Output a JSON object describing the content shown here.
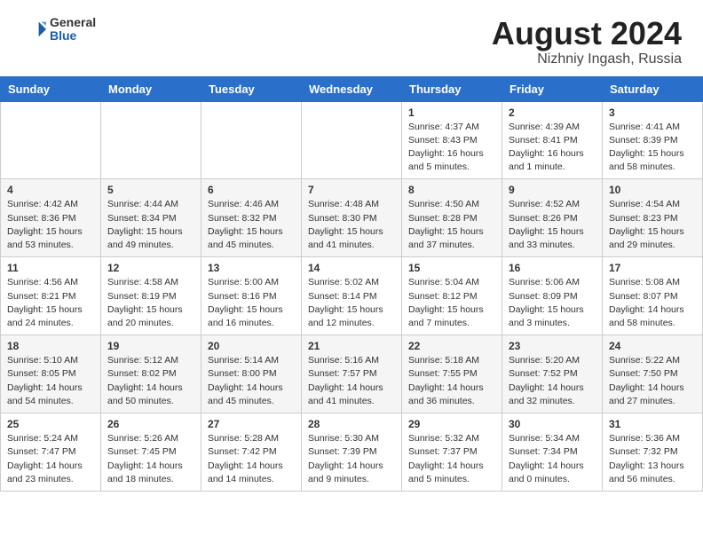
{
  "header": {
    "logo_general": "General",
    "logo_blue": "Blue",
    "month_year": "August 2024",
    "location": "Nizhniy Ingash, Russia"
  },
  "days_of_week": [
    "Sunday",
    "Monday",
    "Tuesday",
    "Wednesday",
    "Thursday",
    "Friday",
    "Saturday"
  ],
  "weeks": [
    [
      {
        "day": "",
        "info": ""
      },
      {
        "day": "",
        "info": ""
      },
      {
        "day": "",
        "info": ""
      },
      {
        "day": "",
        "info": ""
      },
      {
        "day": "1",
        "info": "Sunrise: 4:37 AM\nSunset: 8:43 PM\nDaylight: 16 hours\nand 5 minutes."
      },
      {
        "day": "2",
        "info": "Sunrise: 4:39 AM\nSunset: 8:41 PM\nDaylight: 16 hours\nand 1 minute."
      },
      {
        "day": "3",
        "info": "Sunrise: 4:41 AM\nSunset: 8:39 PM\nDaylight: 15 hours\nand 58 minutes."
      }
    ],
    [
      {
        "day": "4",
        "info": "Sunrise: 4:42 AM\nSunset: 8:36 PM\nDaylight: 15 hours\nand 53 minutes."
      },
      {
        "day": "5",
        "info": "Sunrise: 4:44 AM\nSunset: 8:34 PM\nDaylight: 15 hours\nand 49 minutes."
      },
      {
        "day": "6",
        "info": "Sunrise: 4:46 AM\nSunset: 8:32 PM\nDaylight: 15 hours\nand 45 minutes."
      },
      {
        "day": "7",
        "info": "Sunrise: 4:48 AM\nSunset: 8:30 PM\nDaylight: 15 hours\nand 41 minutes."
      },
      {
        "day": "8",
        "info": "Sunrise: 4:50 AM\nSunset: 8:28 PM\nDaylight: 15 hours\nand 37 minutes."
      },
      {
        "day": "9",
        "info": "Sunrise: 4:52 AM\nSunset: 8:26 PM\nDaylight: 15 hours\nand 33 minutes."
      },
      {
        "day": "10",
        "info": "Sunrise: 4:54 AM\nSunset: 8:23 PM\nDaylight: 15 hours\nand 29 minutes."
      }
    ],
    [
      {
        "day": "11",
        "info": "Sunrise: 4:56 AM\nSunset: 8:21 PM\nDaylight: 15 hours\nand 24 minutes."
      },
      {
        "day": "12",
        "info": "Sunrise: 4:58 AM\nSunset: 8:19 PM\nDaylight: 15 hours\nand 20 minutes."
      },
      {
        "day": "13",
        "info": "Sunrise: 5:00 AM\nSunset: 8:16 PM\nDaylight: 15 hours\nand 16 minutes."
      },
      {
        "day": "14",
        "info": "Sunrise: 5:02 AM\nSunset: 8:14 PM\nDaylight: 15 hours\nand 12 minutes."
      },
      {
        "day": "15",
        "info": "Sunrise: 5:04 AM\nSunset: 8:12 PM\nDaylight: 15 hours\nand 7 minutes."
      },
      {
        "day": "16",
        "info": "Sunrise: 5:06 AM\nSunset: 8:09 PM\nDaylight: 15 hours\nand 3 minutes."
      },
      {
        "day": "17",
        "info": "Sunrise: 5:08 AM\nSunset: 8:07 PM\nDaylight: 14 hours\nand 58 minutes."
      }
    ],
    [
      {
        "day": "18",
        "info": "Sunrise: 5:10 AM\nSunset: 8:05 PM\nDaylight: 14 hours\nand 54 minutes."
      },
      {
        "day": "19",
        "info": "Sunrise: 5:12 AM\nSunset: 8:02 PM\nDaylight: 14 hours\nand 50 minutes."
      },
      {
        "day": "20",
        "info": "Sunrise: 5:14 AM\nSunset: 8:00 PM\nDaylight: 14 hours\nand 45 minutes."
      },
      {
        "day": "21",
        "info": "Sunrise: 5:16 AM\nSunset: 7:57 PM\nDaylight: 14 hours\nand 41 minutes."
      },
      {
        "day": "22",
        "info": "Sunrise: 5:18 AM\nSunset: 7:55 PM\nDaylight: 14 hours\nand 36 minutes."
      },
      {
        "day": "23",
        "info": "Sunrise: 5:20 AM\nSunset: 7:52 PM\nDaylight: 14 hours\nand 32 minutes."
      },
      {
        "day": "24",
        "info": "Sunrise: 5:22 AM\nSunset: 7:50 PM\nDaylight: 14 hours\nand 27 minutes."
      }
    ],
    [
      {
        "day": "25",
        "info": "Sunrise: 5:24 AM\nSunset: 7:47 PM\nDaylight: 14 hours\nand 23 minutes."
      },
      {
        "day": "26",
        "info": "Sunrise: 5:26 AM\nSunset: 7:45 PM\nDaylight: 14 hours\nand 18 minutes."
      },
      {
        "day": "27",
        "info": "Sunrise: 5:28 AM\nSunset: 7:42 PM\nDaylight: 14 hours\nand 14 minutes."
      },
      {
        "day": "28",
        "info": "Sunrise: 5:30 AM\nSunset: 7:39 PM\nDaylight: 14 hours\nand 9 minutes."
      },
      {
        "day": "29",
        "info": "Sunrise: 5:32 AM\nSunset: 7:37 PM\nDaylight: 14 hours\nand 5 minutes."
      },
      {
        "day": "30",
        "info": "Sunrise: 5:34 AM\nSunset: 7:34 PM\nDaylight: 14 hours\nand 0 minutes."
      },
      {
        "day": "31",
        "info": "Sunrise: 5:36 AM\nSunset: 7:32 PM\nDaylight: 13 hours\nand 56 minutes."
      }
    ]
  ]
}
